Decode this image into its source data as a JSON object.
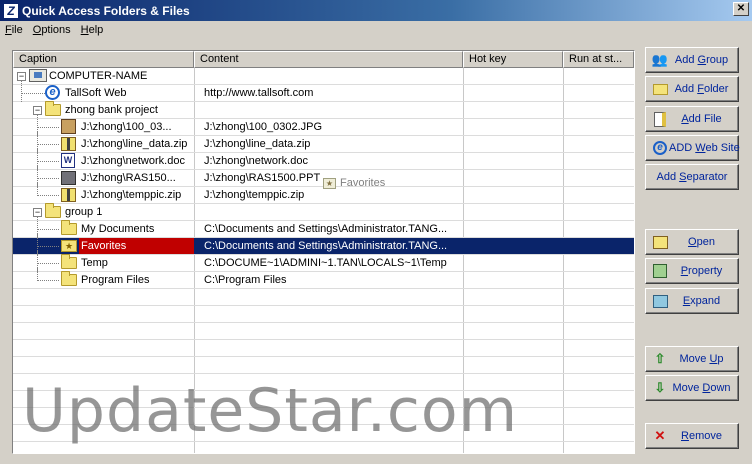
{
  "window": {
    "title": "Quick Access Folders & Files",
    "close_glyph": "✕"
  },
  "menu": [
    {
      "label_u": "F",
      "label_rest": "ile"
    },
    {
      "label_u": "O",
      "label_rest": "ptions"
    },
    {
      "label_u": "H",
      "label_rest": "elp"
    }
  ],
  "grid": {
    "columns": [
      "Caption",
      "Content",
      "Hot key",
      "Run at st..."
    ],
    "rows": [
      {
        "caption": "COMPUTER-NAME",
        "content": "",
        "icon": "computer-icon",
        "selected": false
      },
      {
        "caption": "TallSoft Web",
        "content": "http://www.tallsoft.com",
        "icon": "internet-explorer-icon",
        "selected": false
      },
      {
        "caption": "zhong bank project",
        "content": "",
        "icon": "folder-icon",
        "selected": false
      },
      {
        "caption": "J:\\zhong\\100_03...",
        "content": "J:\\zhong\\100_0302.JPG",
        "icon": "image-file-icon",
        "selected": false
      },
      {
        "caption": "J:\\zhong\\line_data.zip",
        "content": "J:\\zhong\\line_data.zip",
        "icon": "zip-file-icon",
        "selected": false
      },
      {
        "caption": "J:\\zhong\\network.doc",
        "content": "J:\\zhong\\network.doc",
        "icon": "word-document-icon",
        "selected": false
      },
      {
        "caption": "J:\\zhong\\RAS150...",
        "content": "J:\\zhong\\RAS1500.PPT",
        "icon": "powerpoint-file-icon",
        "selected": false
      },
      {
        "caption": "J:\\zhong\\temppic.zip",
        "content": "J:\\zhong\\temppic.zip",
        "icon": "zip-file-icon",
        "selected": false
      },
      {
        "caption": "group 1",
        "content": "",
        "icon": "folder-icon",
        "selected": false
      },
      {
        "caption": "My Documents",
        "content": "C:\\Documents and Settings\\Administrator.TANG...",
        "icon": "folder-icon",
        "selected": false
      },
      {
        "caption": "Favorites",
        "content": "C:\\Documents and Settings\\Administrator.TANG...",
        "icon": "favorites-folder-icon",
        "selected": true
      },
      {
        "caption": "Temp",
        "content": "C:\\DOCUME~1\\ADMINI~1.TAN\\LOCALS~1\\Temp",
        "icon": "folder-icon",
        "selected": false
      },
      {
        "caption": "Program Files",
        "content": "C:\\Program Files",
        "icon": "folder-icon",
        "selected": false
      }
    ],
    "drag_ghost_label": "Favorites"
  },
  "watermark": "UpdateStar.com",
  "buttons": {
    "add_group": {
      "u": "",
      "pre": "Add ",
      "uch": "G",
      "post": "roup",
      "icon": "add-group-icon"
    },
    "add_folder": {
      "pre": "Add ",
      "uch": "F",
      "post": "older",
      "icon": "add-folder-icon"
    },
    "add_file": {
      "pre": "",
      "uch": "A",
      "post": "dd File",
      "icon": "add-file-icon"
    },
    "add_web_site": {
      "pre": "ADD ",
      "uch": "W",
      "post": "eb Site",
      "icon": "add-web-site-icon"
    },
    "add_separator": {
      "pre": "Add ",
      "uch": "S",
      "post": "eparator",
      "icon": ""
    },
    "open": {
      "pre": "",
      "uch": "O",
      "post": "pen",
      "icon": "open-icon"
    },
    "property": {
      "pre": "",
      "uch": "P",
      "post": "roperty",
      "icon": "property-icon"
    },
    "expand": {
      "pre": "",
      "uch": "E",
      "post": "xpand",
      "icon": "expand-icon"
    },
    "move_up": {
      "pre": "Move ",
      "uch": "U",
      "post": "p",
      "icon": "arrow-up-icon"
    },
    "move_down": {
      "pre": "Move ",
      "uch": "D",
      "post": "own",
      "icon": "arrow-down-icon"
    },
    "remove": {
      "pre": "",
      "uch": "R",
      "post": "emove",
      "icon": "remove-icon"
    }
  },
  "colors": {
    "selection": "#0a246a",
    "selected_caption": "#c00000",
    "button_text": "#00249c"
  }
}
